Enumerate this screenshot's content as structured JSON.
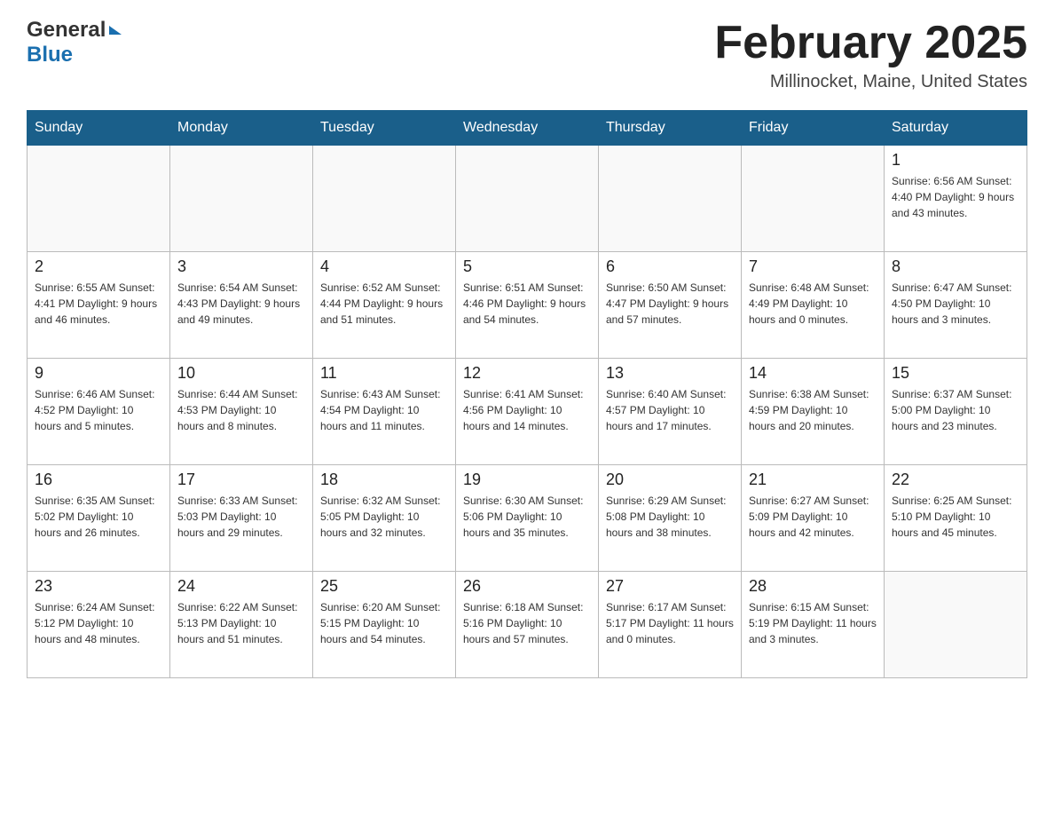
{
  "header": {
    "logo": {
      "general": "General",
      "blue": "Blue",
      "arrow": "▶"
    },
    "title": "February 2025",
    "location": "Millinocket, Maine, United States"
  },
  "calendar": {
    "days_of_week": [
      "Sunday",
      "Monday",
      "Tuesday",
      "Wednesday",
      "Thursday",
      "Friday",
      "Saturday"
    ],
    "weeks": [
      [
        {
          "day": "",
          "info": ""
        },
        {
          "day": "",
          "info": ""
        },
        {
          "day": "",
          "info": ""
        },
        {
          "day": "",
          "info": ""
        },
        {
          "day": "",
          "info": ""
        },
        {
          "day": "",
          "info": ""
        },
        {
          "day": "1",
          "info": "Sunrise: 6:56 AM\nSunset: 4:40 PM\nDaylight: 9 hours and 43 minutes."
        }
      ],
      [
        {
          "day": "2",
          "info": "Sunrise: 6:55 AM\nSunset: 4:41 PM\nDaylight: 9 hours and 46 minutes."
        },
        {
          "day": "3",
          "info": "Sunrise: 6:54 AM\nSunset: 4:43 PM\nDaylight: 9 hours and 49 minutes."
        },
        {
          "day": "4",
          "info": "Sunrise: 6:52 AM\nSunset: 4:44 PM\nDaylight: 9 hours and 51 minutes."
        },
        {
          "day": "5",
          "info": "Sunrise: 6:51 AM\nSunset: 4:46 PM\nDaylight: 9 hours and 54 minutes."
        },
        {
          "day": "6",
          "info": "Sunrise: 6:50 AM\nSunset: 4:47 PM\nDaylight: 9 hours and 57 minutes."
        },
        {
          "day": "7",
          "info": "Sunrise: 6:48 AM\nSunset: 4:49 PM\nDaylight: 10 hours and 0 minutes."
        },
        {
          "day": "8",
          "info": "Sunrise: 6:47 AM\nSunset: 4:50 PM\nDaylight: 10 hours and 3 minutes."
        }
      ],
      [
        {
          "day": "9",
          "info": "Sunrise: 6:46 AM\nSunset: 4:52 PM\nDaylight: 10 hours and 5 minutes."
        },
        {
          "day": "10",
          "info": "Sunrise: 6:44 AM\nSunset: 4:53 PM\nDaylight: 10 hours and 8 minutes."
        },
        {
          "day": "11",
          "info": "Sunrise: 6:43 AM\nSunset: 4:54 PM\nDaylight: 10 hours and 11 minutes."
        },
        {
          "day": "12",
          "info": "Sunrise: 6:41 AM\nSunset: 4:56 PM\nDaylight: 10 hours and 14 minutes."
        },
        {
          "day": "13",
          "info": "Sunrise: 6:40 AM\nSunset: 4:57 PM\nDaylight: 10 hours and 17 minutes."
        },
        {
          "day": "14",
          "info": "Sunrise: 6:38 AM\nSunset: 4:59 PM\nDaylight: 10 hours and 20 minutes."
        },
        {
          "day": "15",
          "info": "Sunrise: 6:37 AM\nSunset: 5:00 PM\nDaylight: 10 hours and 23 minutes."
        }
      ],
      [
        {
          "day": "16",
          "info": "Sunrise: 6:35 AM\nSunset: 5:02 PM\nDaylight: 10 hours and 26 minutes."
        },
        {
          "day": "17",
          "info": "Sunrise: 6:33 AM\nSunset: 5:03 PM\nDaylight: 10 hours and 29 minutes."
        },
        {
          "day": "18",
          "info": "Sunrise: 6:32 AM\nSunset: 5:05 PM\nDaylight: 10 hours and 32 minutes."
        },
        {
          "day": "19",
          "info": "Sunrise: 6:30 AM\nSunset: 5:06 PM\nDaylight: 10 hours and 35 minutes."
        },
        {
          "day": "20",
          "info": "Sunrise: 6:29 AM\nSunset: 5:08 PM\nDaylight: 10 hours and 38 minutes."
        },
        {
          "day": "21",
          "info": "Sunrise: 6:27 AM\nSunset: 5:09 PM\nDaylight: 10 hours and 42 minutes."
        },
        {
          "day": "22",
          "info": "Sunrise: 6:25 AM\nSunset: 5:10 PM\nDaylight: 10 hours and 45 minutes."
        }
      ],
      [
        {
          "day": "23",
          "info": "Sunrise: 6:24 AM\nSunset: 5:12 PM\nDaylight: 10 hours and 48 minutes."
        },
        {
          "day": "24",
          "info": "Sunrise: 6:22 AM\nSunset: 5:13 PM\nDaylight: 10 hours and 51 minutes."
        },
        {
          "day": "25",
          "info": "Sunrise: 6:20 AM\nSunset: 5:15 PM\nDaylight: 10 hours and 54 minutes."
        },
        {
          "day": "26",
          "info": "Sunrise: 6:18 AM\nSunset: 5:16 PM\nDaylight: 10 hours and 57 minutes."
        },
        {
          "day": "27",
          "info": "Sunrise: 6:17 AM\nSunset: 5:17 PM\nDaylight: 11 hours and 0 minutes."
        },
        {
          "day": "28",
          "info": "Sunrise: 6:15 AM\nSunset: 5:19 PM\nDaylight: 11 hours and 3 minutes."
        },
        {
          "day": "",
          "info": ""
        }
      ]
    ]
  }
}
